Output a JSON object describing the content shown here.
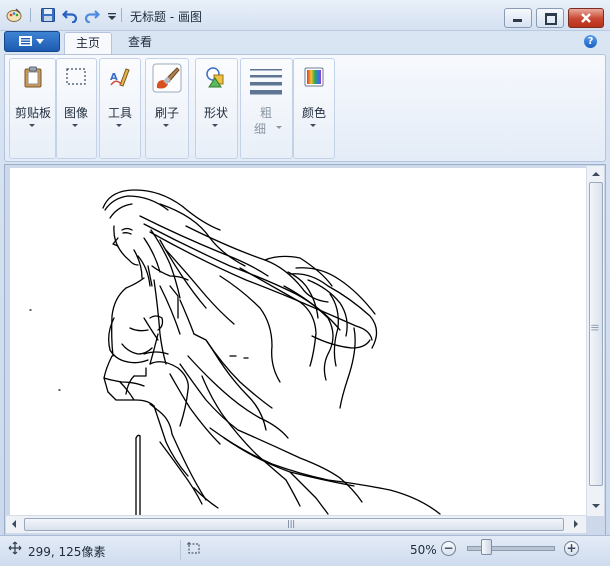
{
  "window": {
    "title": "无标题 - 画图"
  },
  "tabs": [
    {
      "label": "主页",
      "active": true
    },
    {
      "label": "查看",
      "active": false
    }
  ],
  "help_label": "?",
  "ribbon": {
    "groups": [
      {
        "label": "剪贴板",
        "icon": "clipboard-icon"
      },
      {
        "label": "图像",
        "icon": "select-icon"
      },
      {
        "label": "工具",
        "icon": "tools-icon"
      },
      {
        "label": "刷子",
        "icon": "brush-icon"
      },
      {
        "label": "形状",
        "icon": "shapes-icon"
      },
      {
        "label": "粗",
        "label2": "细",
        "icon": "size-icon",
        "disabled": true
      },
      {
        "label": "颜色",
        "icon": "colors-icon"
      }
    ]
  },
  "status": {
    "position": "299, 125像素",
    "selection": "",
    "zoom": "50%",
    "zoom_fraction": 0.25
  },
  "scroll_grip": "|||",
  "colors": {
    "accent": "#1c5bb1",
    "close": "#c8452f",
    "canvas": "#ffffff"
  }
}
